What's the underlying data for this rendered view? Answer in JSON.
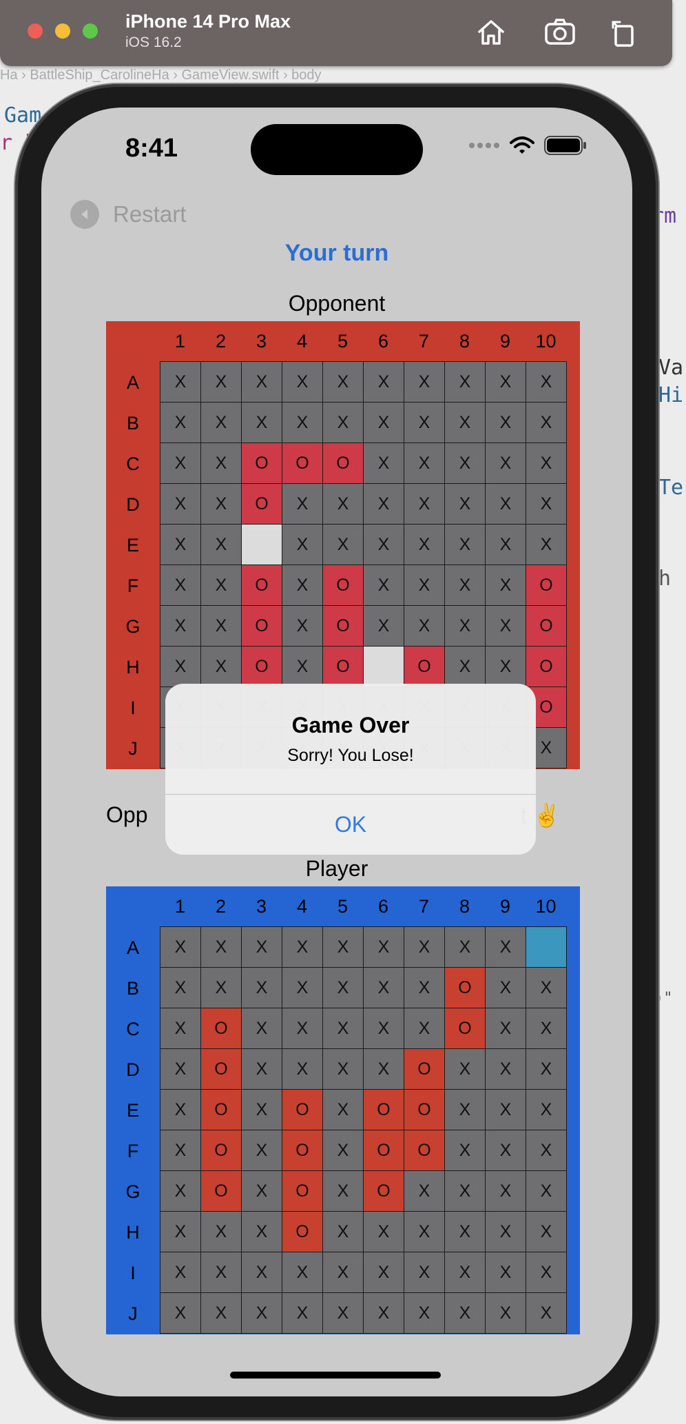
{
  "simulator": {
    "device_name": "iPhone 14 Pro Max",
    "os_version": "iOS 16.2",
    "breadcrumb": [
      "Ha",
      "BattleShip_CarolineHa",
      "GameView.swift",
      "body"
    ]
  },
  "status_bar": {
    "time": "8:41"
  },
  "nav": {
    "restart_label": "Restart"
  },
  "turn_label": "Your turn",
  "columns": [
    "1",
    "2",
    "3",
    "4",
    "5",
    "6",
    "7",
    "8",
    "9",
    "10"
  ],
  "rows": [
    "A",
    "B",
    "C",
    "D",
    "E",
    "F",
    "G",
    "H",
    "I",
    "J"
  ],
  "opponent": {
    "label": "Opponent",
    "color": "#c63c2e",
    "grid": [
      [
        "x",
        "x",
        "x",
        "x",
        "x",
        "x",
        "x",
        "x",
        "x",
        "x"
      ],
      [
        "x",
        "x",
        "x",
        "x",
        "x",
        "x",
        "x",
        "x",
        "x",
        "x"
      ],
      [
        "x",
        "x",
        "hit",
        "hit",
        "hit",
        "x",
        "x",
        "x",
        "x",
        "x"
      ],
      [
        "x",
        "x",
        "hit",
        "x",
        "x",
        "x",
        "x",
        "x",
        "x",
        "x"
      ],
      [
        "x",
        "x",
        "empty",
        "x",
        "x",
        "x",
        "x",
        "x",
        "x",
        "x"
      ],
      [
        "x",
        "x",
        "hit",
        "x",
        "hit",
        "x",
        "x",
        "x",
        "x",
        "hit"
      ],
      [
        "x",
        "x",
        "hit",
        "x",
        "hit",
        "x",
        "x",
        "x",
        "x",
        "hit"
      ],
      [
        "x",
        "x",
        "hit",
        "x",
        "hit",
        "empty",
        "hit",
        "x",
        "x",
        "hit"
      ],
      [
        "x",
        "x",
        "x",
        "x",
        "x",
        "x",
        "x",
        "x",
        "x",
        "hit"
      ],
      [
        "x",
        "x",
        "x",
        "x",
        "x",
        "x",
        "x",
        "x",
        "x",
        "x"
      ]
    ]
  },
  "summary": {
    "left": "Opp",
    "right": "t ✌️"
  },
  "player": {
    "label": "Player",
    "color": "#2565d3",
    "grid": [
      [
        "x",
        "x",
        "x",
        "x",
        "x",
        "x",
        "x",
        "x",
        "x",
        "water"
      ],
      [
        "x",
        "x",
        "x",
        "x",
        "x",
        "x",
        "x",
        "ship",
        "x",
        "x"
      ],
      [
        "x",
        "ship",
        "x",
        "x",
        "x",
        "x",
        "x",
        "ship",
        "x",
        "x"
      ],
      [
        "x",
        "ship",
        "x",
        "x",
        "x",
        "x",
        "ship",
        "x",
        "x",
        "x"
      ],
      [
        "x",
        "ship",
        "x",
        "ship",
        "x",
        "ship",
        "ship",
        "x",
        "x",
        "x"
      ],
      [
        "x",
        "ship",
        "x",
        "ship",
        "x",
        "ship",
        "ship",
        "x",
        "x",
        "x"
      ],
      [
        "x",
        "ship",
        "x",
        "ship",
        "x",
        "ship",
        "x",
        "x",
        "x",
        "x"
      ],
      [
        "x",
        "x",
        "x",
        "ship",
        "x",
        "x",
        "x",
        "x",
        "x",
        "x"
      ],
      [
        "x",
        "x",
        "x",
        "x",
        "x",
        "x",
        "x",
        "x",
        "x",
        "x"
      ],
      [
        "x",
        "x",
        "x",
        "x",
        "x",
        "x",
        "x",
        "x",
        "x",
        "x"
      ]
    ]
  },
  "cell_marks": {
    "x": "X",
    "hit": "O",
    "ship": "O",
    "empty": "",
    "water": ""
  },
  "alert": {
    "title": "Game Over",
    "message": "Sorry! You Lose!",
    "ok_label": "OK"
  },
  "background_code": [
    "Gam",
    "r b",
    "rm",
    "Va",
    "Hi",
    "Te",
    "h",
    ")\""
  ]
}
